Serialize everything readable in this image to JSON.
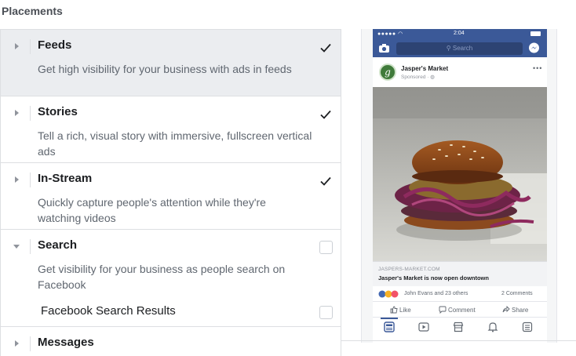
{
  "heading": "Placements",
  "placements": [
    {
      "title": "Feeds",
      "description": "Get high visibility for your business with ads in feeds",
      "checked": true,
      "expanded": false,
      "selected": true
    },
    {
      "title": "Stories",
      "description": "Tell a rich, visual story with immersive, fullscreen vertical ads",
      "checked": true,
      "expanded": false,
      "selected": false
    },
    {
      "title": "In-Stream",
      "description": "Quickly capture people's attention while they're watching videos",
      "checked": true,
      "expanded": false,
      "selected": false
    },
    {
      "title": "Search",
      "description": "Get visibility for your business as people search on Facebook",
      "checked": false,
      "expanded": true,
      "selected": false,
      "subitems": [
        {
          "label": "Facebook Search Results",
          "checked": false
        }
      ]
    },
    {
      "title": "Messages",
      "checked": false,
      "expanded": false,
      "selected": false
    }
  ],
  "preview": {
    "status_time": "2:04",
    "search_placeholder": "Search",
    "page_name": "Jasper's Market",
    "sponsored": "Sponsored · ",
    "avatar_letter": "g",
    "link_domain": "JASPERS-MARKET.COM",
    "link_title": "Jasper's Market is now open downtown",
    "reactions_text": "John Evans and 23 others",
    "comments_text": "2 Comments",
    "actions": {
      "like": "Like",
      "comment": "Comment",
      "share": "Share"
    }
  },
  "colors": {
    "facebook_blue": "#3b5998",
    "selected_row": "#ebedf0",
    "border": "#dddfe2"
  },
  "icons": [
    "caret-right-icon",
    "caret-down-icon",
    "checkmark-icon",
    "camera-icon",
    "messenger-icon",
    "like-icon",
    "comment-icon",
    "share-icon",
    "news-feed-icon",
    "video-icon",
    "marketplace-icon",
    "notifications-icon",
    "menu-icon"
  ]
}
